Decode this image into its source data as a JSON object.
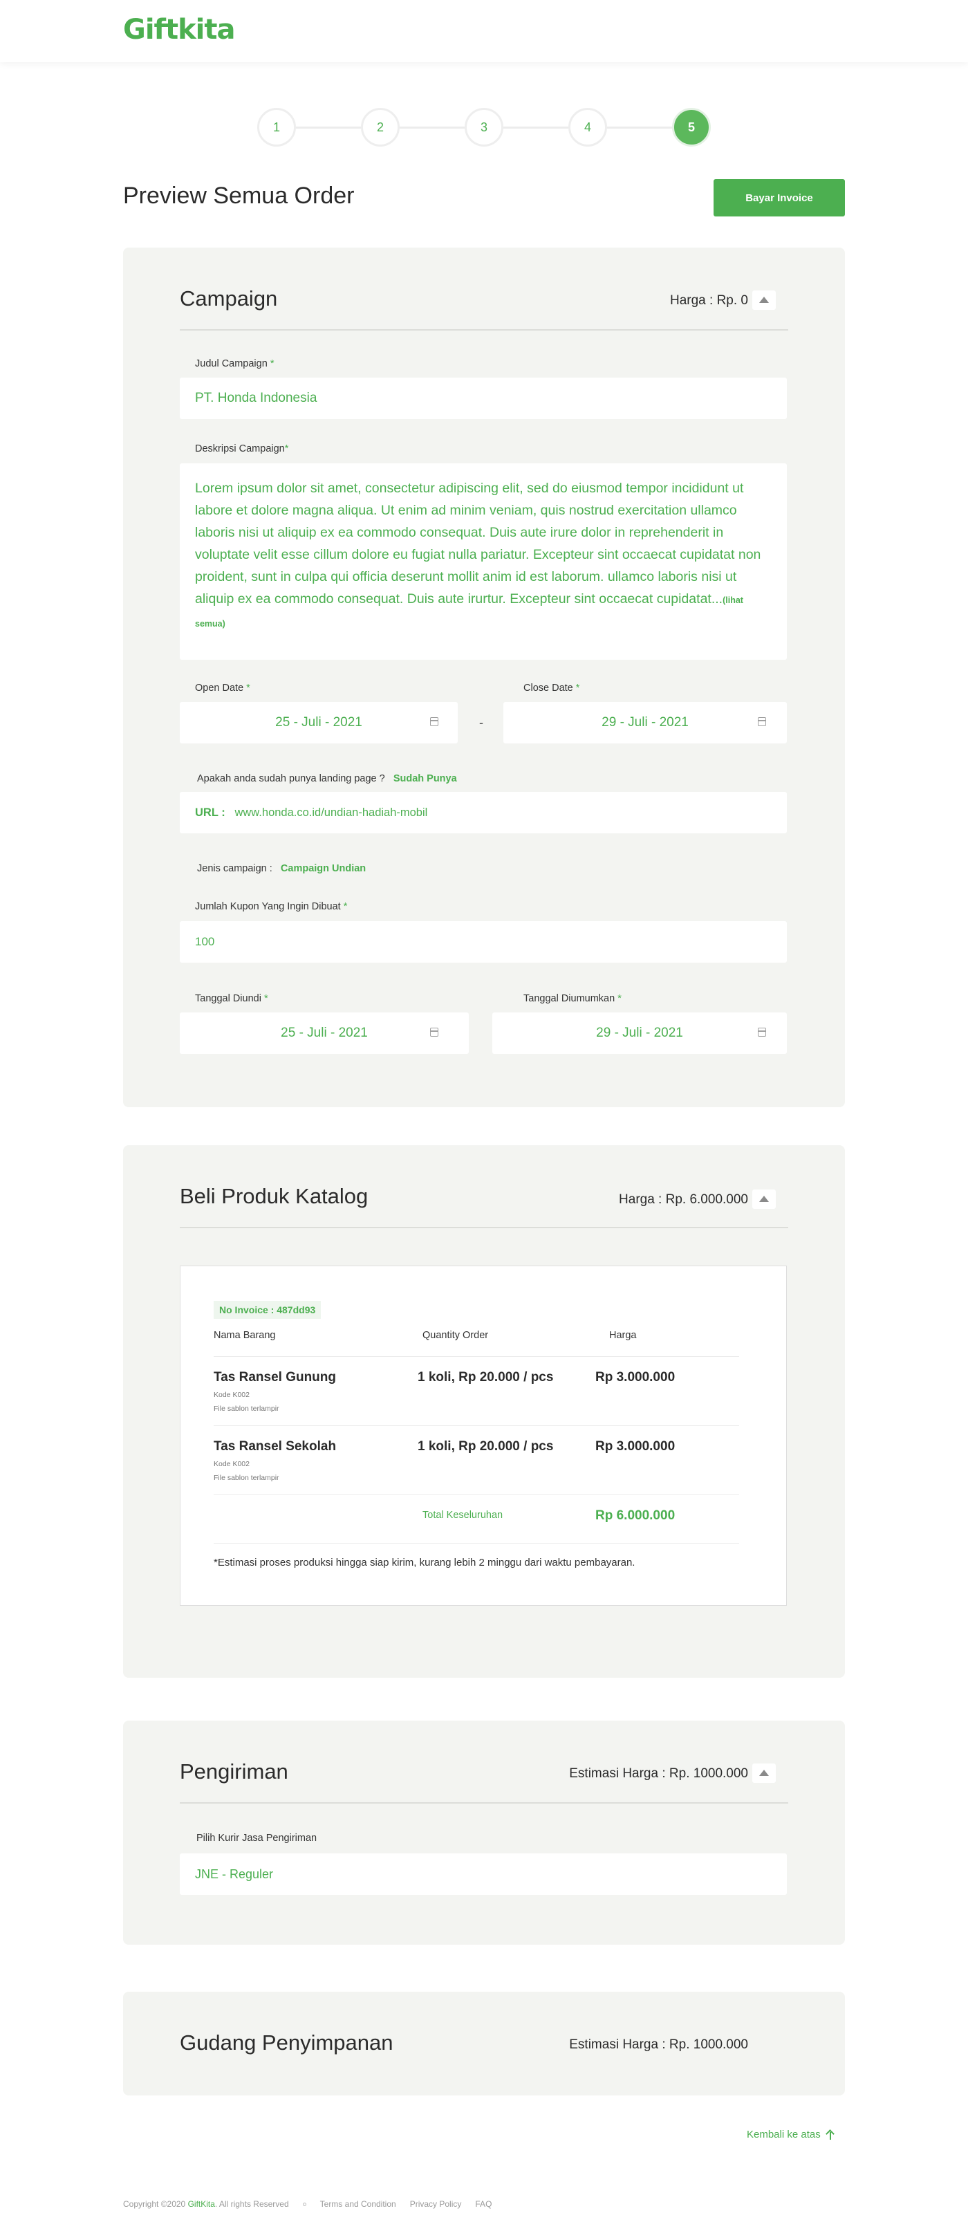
{
  "header": {
    "logo": "Giftkita"
  },
  "stepper": {
    "steps": [
      "1",
      "2",
      "3",
      "4",
      "5"
    ],
    "active_step": 5
  },
  "page": {
    "title": "Preview Semua Order",
    "pay_button": "Bayar Invoice"
  },
  "campaign": {
    "title": "Campaign",
    "price": "Harga : Rp. 0",
    "judul_label": "Judul Campaign ",
    "judul_value": "PT. Honda Indonesia",
    "deskripsi_label": "Deskripsi Campaign",
    "deskripsi_value": "Lorem ipsum dolor sit amet, consectetur adipiscing elit, sed do eiusmod tempor incididunt ut labore et dolore magna aliqua. Ut enim ad minim veniam, quis nostrud exercitation ullamco laboris nisi ut aliquip ex ea commodo consequat. Duis aute irure dolor in reprehenderit in voluptate velit esse cillum dolore eu fugiat nulla pariatur. Excepteur sint occaecat cupidatat non proident, sunt in culpa qui officia deserunt mollit anim id est laborum. ullamco laboris nisi ut aliquip ex ea commodo consequat. Duis aute irurtur. Excepteur sint occaecat cupidatat...",
    "deskripsi_more": "(lihat semua)",
    "open_date_label": "Open Date ",
    "open_date": "25 - Juli - 2021",
    "close_date_label": "Close Date ",
    "close_date": "29 - Juli - 2021",
    "date_separator": "-",
    "landing_question": "Apakah anda sudah punya landing page ?",
    "landing_answer": "Sudah Punya",
    "url_label": "URL :",
    "url_value": "www.honda.co.id/undian-hadiah-mobil",
    "jenis_label": "Jenis campaign :",
    "jenis_value": "Campaign Undian",
    "kupon_label": "Jumlah Kupon Yang Ingin Dibuat ",
    "kupon_value": "100",
    "diundi_label": "Tanggal Diundi ",
    "diundi_value": "25 - Juli - 2021",
    "diumumkan_label": "Tanggal Diumumkan ",
    "diumumkan_value": "29 - Juli - 2021",
    "required_mark": "*"
  },
  "katalog": {
    "title": "Beli Produk Katalog",
    "price": "Harga : Rp. 6.000.000",
    "invoice_no": "No Invoice : 487dd93",
    "columns": [
      "Nama Barang",
      "Quantity Order",
      "Harga"
    ],
    "items": [
      {
        "name": "Tas Ransel Gunung",
        "code": "Kode K002",
        "file": "File sablon terlampir",
        "qty": "1 koli, Rp 20.000 / pcs",
        "price": "Rp 3.000.000"
      },
      {
        "name": "Tas Ransel Sekolah",
        "code": "Kode K002",
        "file": "File sablon terlampir",
        "qty": "1 koli, Rp 20.000 / pcs",
        "price": "Rp 3.000.000"
      }
    ],
    "total_label": "Total Keseluruhan",
    "total_value": "Rp 6.000.000",
    "note": "*Estimasi proses produksi hingga siap kirim, kurang lebih 2 minggu dari waktu pembayaran."
  },
  "pengiriman": {
    "title": "Pengiriman",
    "price": "Estimasi Harga : Rp. 1000.000",
    "kurir_label": "Pilih Kurir Jasa Pengiriman",
    "kurir_value": "JNE - Reguler"
  },
  "gudang": {
    "title": "Gudang Penyimpanan",
    "price": "Estimasi Harga : Rp. 1000.000"
  },
  "back_to_top": "Kembali ke atas",
  "footer": {
    "copyright_prefix": "Copyright ©2020 ",
    "brand": "GiftKita",
    "copyright_suffix": ". All rights Reserved",
    "links": [
      "Terms and Condition",
      "Privacy Policy",
      "FAQ"
    ]
  },
  "colors": {
    "accent": "#4caf50",
    "card_bg": "#f3f4f1"
  }
}
